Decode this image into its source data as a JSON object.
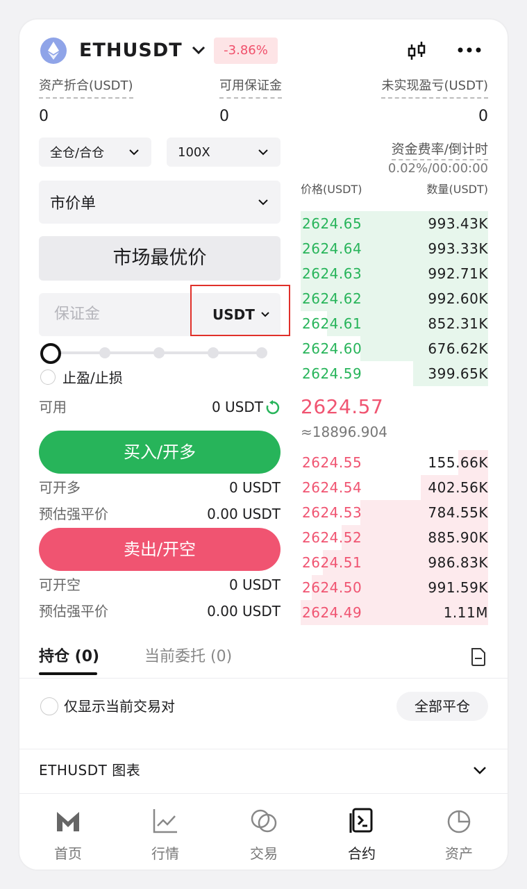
{
  "header": {
    "pair": "ETHUSDT",
    "change": "-3.86%",
    "icons": [
      "eth-logo",
      "chevron-down-icon",
      "candlestick-icon",
      "more-icon"
    ]
  },
  "summary": {
    "assets_label": "资产折合(USDT)",
    "assets_value": "0",
    "margin_label": "可用保证金",
    "margin_value": "0",
    "pnl_label": "未实现盈亏(USDT)",
    "pnl_value": "0"
  },
  "controls": {
    "margin_mode": "全仓/合仓",
    "leverage": "100X",
    "order_type": "市价单",
    "best_price": "市场最优价",
    "margin_placeholder": "保证金",
    "unit": "USDT",
    "slider_level": 0,
    "tpsl_label": "止盈/止损",
    "available_label": "可用",
    "available_value": "0 USDT",
    "buy_label": "买入/开多",
    "long_label": "可开多",
    "long_value": "0 USDT",
    "liq_label_1": "预估强平价",
    "liq_value_1": "0.00 USDT",
    "sell_label": "卖出/开空",
    "short_label": "可开空",
    "short_value": "0 USDT",
    "liq_label_2": "预估强平价",
    "liq_value_2": "0.00 USDT"
  },
  "funding": {
    "label": "资金费率/倒计时",
    "value": "0.02%/00:00:00"
  },
  "orderbook": {
    "price_header": "价格(USDT)",
    "qty_header": "数量(USDT)",
    "asks": [
      {
        "price": "2624.65",
        "qty": "993.43K",
        "depth": 1.0
      },
      {
        "price": "2624.64",
        "qty": "993.33K",
        "depth": 1.0
      },
      {
        "price": "2624.63",
        "qty": "992.71K",
        "depth": 1.0
      },
      {
        "price": "2624.62",
        "qty": "992.60K",
        "depth": 1.0
      },
      {
        "price": "2624.61",
        "qty": "852.31K",
        "depth": 0.86
      },
      {
        "price": "2624.60",
        "qty": "676.62K",
        "depth": 0.68
      },
      {
        "price": "2624.59",
        "qty": "399.65K",
        "depth": 0.4
      }
    ],
    "last_price": "2624.57",
    "last_fiat": "≈18896.904",
    "bids": [
      {
        "price": "2624.55",
        "qty": "155.66K",
        "depth": 0.16
      },
      {
        "price": "2624.54",
        "qty": "402.56K",
        "depth": 0.36
      },
      {
        "price": "2624.53",
        "qty": "784.55K",
        "depth": 0.68
      },
      {
        "price": "2624.52",
        "qty": "885.90K",
        "depth": 0.78
      },
      {
        "price": "2624.51",
        "qty": "986.83K",
        "depth": 0.88
      },
      {
        "price": "2624.50",
        "qty": "991.59K",
        "depth": 0.94
      },
      {
        "price": "2624.49",
        "qty": "1.11M",
        "depth": 1.0
      }
    ],
    "ask_color": "#27b45a",
    "bid_color": "#f05471"
  },
  "positions": {
    "tab_positions": "持仓 (0)",
    "tab_orders": "当前委托 (0)",
    "only_current": "仅显示当前交易对",
    "close_all": "全部平仓",
    "chart_label": "ETHUSDT  图表"
  },
  "nav": {
    "items": [
      {
        "label": "首页",
        "icon": "home-m-icon"
      },
      {
        "label": "行情",
        "icon": "market-chart-icon"
      },
      {
        "label": "交易",
        "icon": "trade-circles-icon"
      },
      {
        "label": "合约",
        "icon": "contract-doc-icon"
      },
      {
        "label": "资产",
        "icon": "assets-pie-icon"
      }
    ],
    "active": 3
  }
}
